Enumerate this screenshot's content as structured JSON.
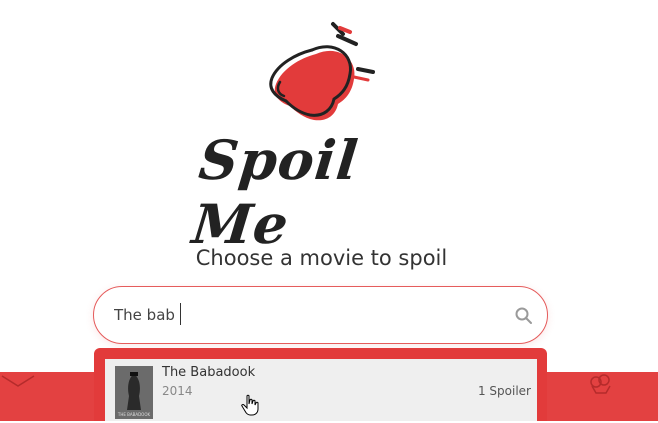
{
  "brand": {
    "name": "Spoil Me"
  },
  "headline": "Choose a movie to spoil",
  "search": {
    "value": "The bab",
    "icon": "search-icon"
  },
  "results": [
    {
      "title": "The Babadook",
      "year": "2014",
      "spoilers": "1 Spoiler",
      "poster_caption": "THE BABADOOK"
    }
  ],
  "colors": {
    "accent": "#e23b3b",
    "text": "#333333",
    "result_bg": "#efefef"
  }
}
